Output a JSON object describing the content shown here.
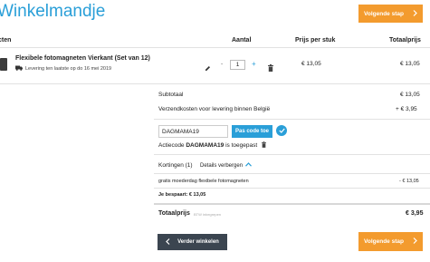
{
  "page": {
    "title": "Winkelmandje"
  },
  "nav": {
    "next_step_label": "Volgende stap",
    "continue_label": "Verder winkelen"
  },
  "table": {
    "col_products": "cten",
    "col_quantity": "Aantal",
    "col_price": "Prijs per stuk",
    "col_total": "Totaalprijs"
  },
  "item": {
    "name": "Flexibele fotomagneten Vierkant (Set van 12)",
    "delivery": "Levering ten laatste op do 16 mei 2019",
    "quantity": "1",
    "minus": "-",
    "plus": "+",
    "price": "€ 13,05",
    "total": "€ 13,05"
  },
  "summary": {
    "subtotal_label": "Subtotaal",
    "subtotal_value": "€ 13,05",
    "shipping_label": "Verzendkosten voor levering binnen België",
    "shipping_value": "+ € 3,95",
    "coupon_value": "DAGMAMA19",
    "coupon_button": "Pas code toe",
    "coupon_applied_prefix": "Actiecode ",
    "coupon_applied_code": "DAGMAMA19",
    "coupon_applied_suffix": " is toegepast",
    "discounts_label": "Kortingen (1)",
    "discounts_toggle": "Details verbergen",
    "discount_name": "gratis moederdag flexibele fotomagneten",
    "discount_value": "- € 13,05",
    "savings": "Je bespaart: € 13,05",
    "total_label": "Totaalprijs",
    "vat_note": "BTW inbegrepen",
    "total_value": "€ 3,95"
  },
  "colors": {
    "accent": "#2a9fd8",
    "cta": "#f39b2e",
    "dark_button": "#3b4550"
  }
}
